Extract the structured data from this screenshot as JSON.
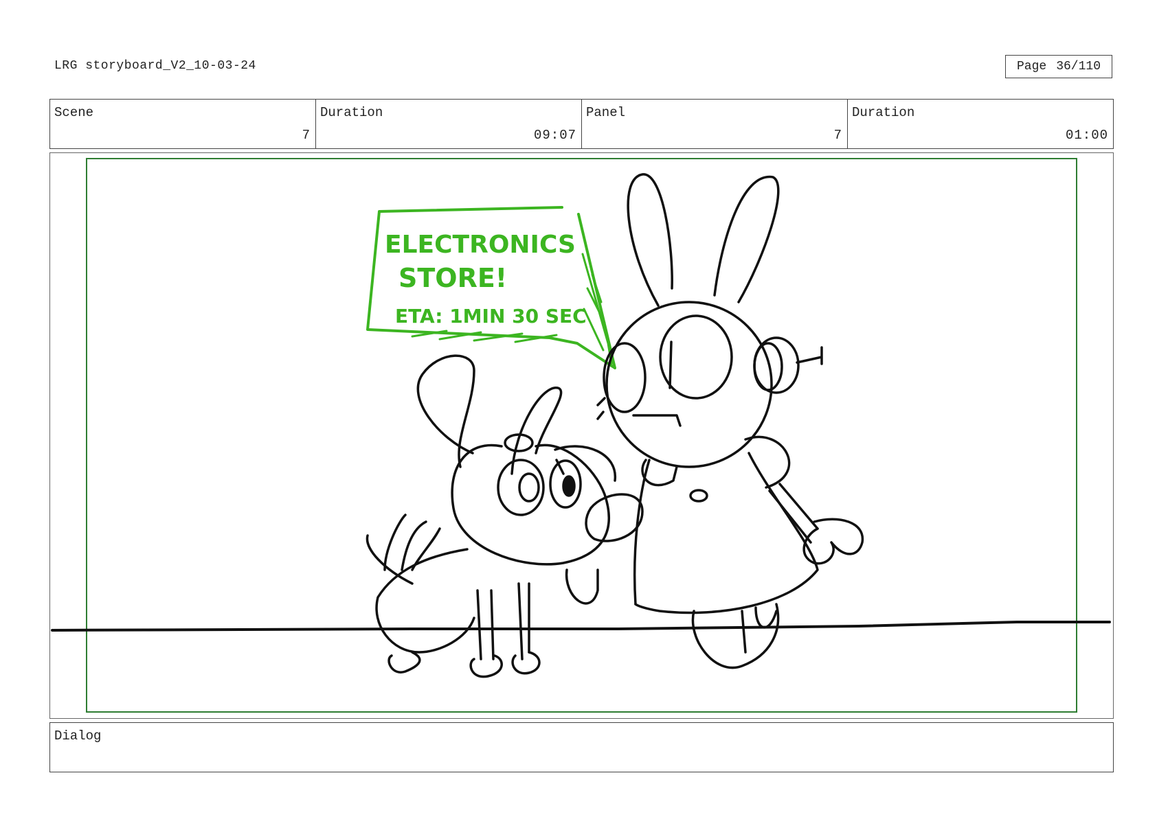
{
  "document": {
    "title": "LRG storyboard_V2_10-03-24",
    "page_label": "Page",
    "page_number": "36/110"
  },
  "info": {
    "scene_label": "Scene",
    "scene_value": "7",
    "scene_duration_label": "Duration",
    "scene_duration_value": "09:07",
    "panel_label": "Panel",
    "panel_value": "7",
    "panel_duration_label": "Duration",
    "panel_duration_value": "01:00"
  },
  "sketch": {
    "sign_line1": "ELECTRONICS",
    "sign_line2": "STORE!",
    "sign_line3": "ETA: 1MIN 30 SEC",
    "sign_color": "#3cb521",
    "safe_frame_color": "#2e7d32"
  },
  "dialog": {
    "label": "Dialog",
    "text": ""
  }
}
